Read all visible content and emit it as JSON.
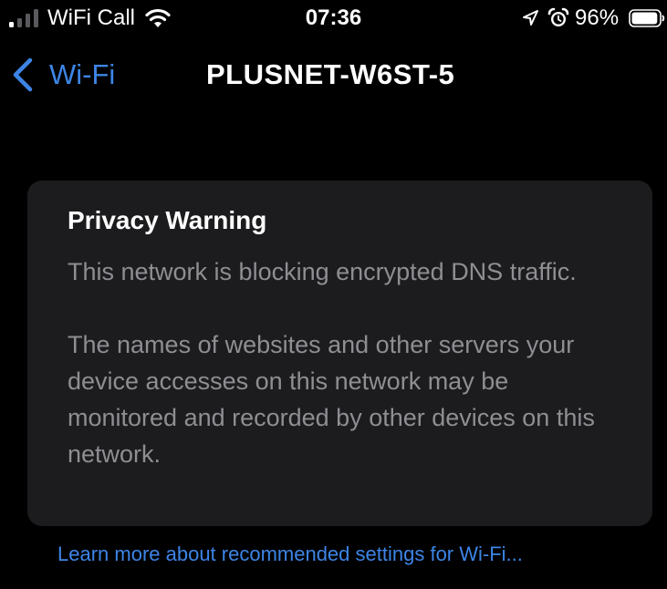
{
  "status_bar": {
    "carrier": "WiFi Call",
    "time": "07:36",
    "battery_percent": "96%",
    "battery_level": 0.96,
    "signal_bars_active": 1,
    "signal_bars_total": 4,
    "icons": [
      "signal-icon",
      "wifi-icon",
      "location-icon",
      "alarm-icon",
      "battery-icon"
    ]
  },
  "nav": {
    "back_label": "Wi-Fi",
    "title": "PLUSNET-W6ST-5"
  },
  "warning": {
    "title": "Privacy Warning",
    "paragraph_1": "This network is blocking encrypted DNS traffic.",
    "paragraph_2": "The names of websites and other servers your device accesses on this network may be monitored and recorded by other devices on this network."
  },
  "footer": {
    "link_text": "Learn more about recommended settings for Wi-Fi..."
  },
  "colors": {
    "background": "#000000",
    "card_background": "#1c1c1e",
    "accent_blue": "#3d85e6",
    "secondary_text": "#8e8e93",
    "primary_text": "#ffffff"
  }
}
